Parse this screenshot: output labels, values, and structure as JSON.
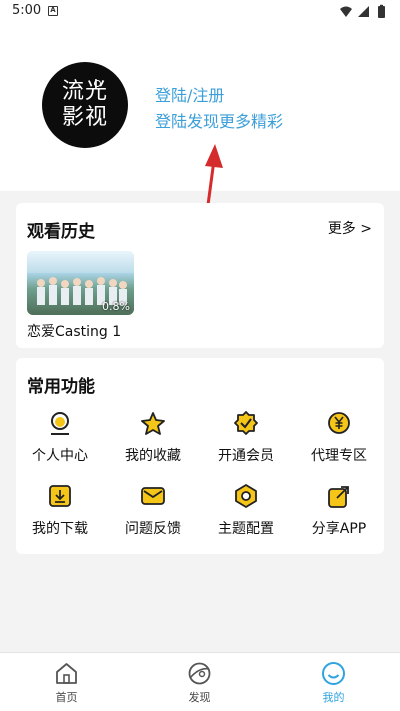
{
  "status_bar": {
    "time": "5:00",
    "notification_letter": "A"
  },
  "header": {
    "avatar_lines": [
      "流光",
      "影视"
    ],
    "login_label": "登陆/注册",
    "login_subtitle": "登陆发现更多精彩"
  },
  "history": {
    "title": "观看历史",
    "more_label": "更多 >",
    "items": [
      {
        "name": "恋爱Casting 1",
        "progress": "0.8%"
      }
    ]
  },
  "features": {
    "title": "常用功能",
    "items": [
      {
        "label": "个人中心",
        "icon": "person-icon"
      },
      {
        "label": "我的收藏",
        "icon": "star-icon"
      },
      {
        "label": "开通会员",
        "icon": "vip-badge-icon"
      },
      {
        "label": "代理专区",
        "icon": "yuan-icon"
      },
      {
        "label": "我的下载",
        "icon": "download-icon"
      },
      {
        "label": "问题反馈",
        "icon": "mail-icon"
      },
      {
        "label": "主题配置",
        "icon": "theme-icon"
      },
      {
        "label": "分享APP",
        "icon": "share-icon"
      }
    ]
  },
  "colors": {
    "accent": "#3c9fd8",
    "icon_yellow": "#f5c518",
    "icon_dark": "#222222",
    "nav_active": "#2fa3e0"
  },
  "bottom_nav": {
    "items": [
      {
        "label": "首页",
        "icon": "home-icon",
        "active": false
      },
      {
        "label": "发现",
        "icon": "discover-icon",
        "active": false
      },
      {
        "label": "我的",
        "icon": "profile-smile-icon",
        "active": true
      }
    ]
  }
}
